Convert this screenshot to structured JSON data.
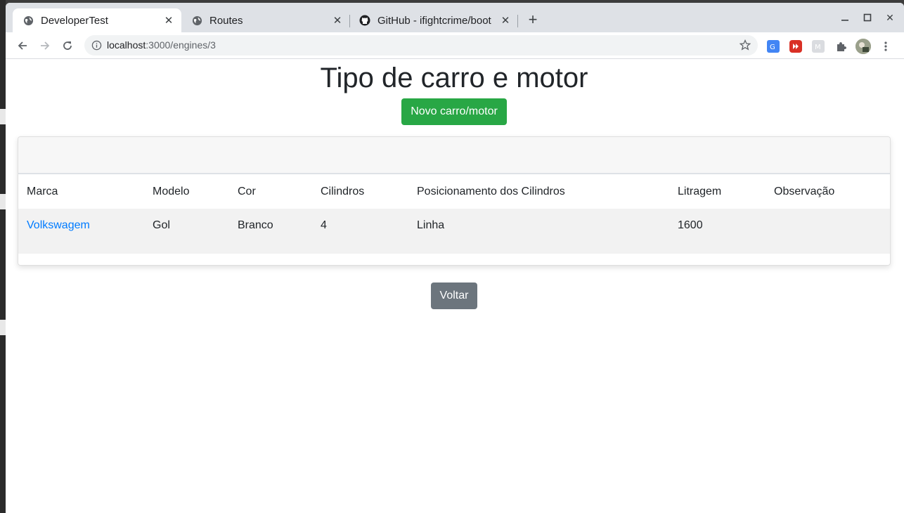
{
  "browser": {
    "tabs": [
      {
        "title": "DeveloperTest",
        "active": true
      },
      {
        "title": "Routes",
        "active": false
      },
      {
        "title": "GitHub - ifightcrime/boot",
        "active": false
      }
    ],
    "url_host": "localhost",
    "url_path": ":3000/engines/3"
  },
  "page": {
    "heading": "Tipo de carro e motor",
    "new_button": "Novo carro/motor",
    "back_button": "Voltar",
    "table": {
      "headers": [
        "Marca",
        "Modelo",
        "Cor",
        "Cilindros",
        "Posicionamento dos Cilindros",
        "Litragem",
        "Observação"
      ],
      "rows": [
        [
          "Volkswagem",
          "Gol",
          "Branco",
          "4",
          "Linha",
          "1600",
          ""
        ]
      ]
    }
  },
  "colors": {
    "success": "#28a745",
    "secondary": "#6c757d",
    "link": "#007bff"
  }
}
